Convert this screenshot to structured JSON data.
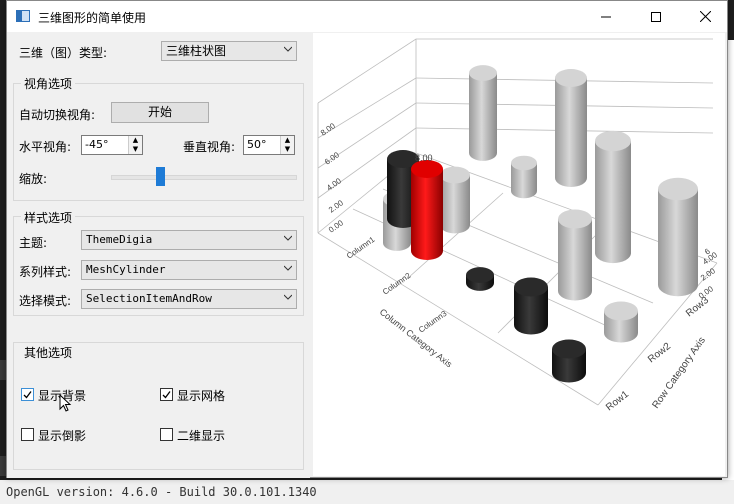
{
  "window": {
    "title": "三维图形的简单使用"
  },
  "background": {
    "status_text": "OpenGL version: 4.6.0 - Build 30.0.101.1340"
  },
  "graph_type": {
    "label": "三维（图）类型:",
    "value": "三维柱状图"
  },
  "view_options": {
    "title": "视角选项",
    "auto_rotate_label": "自动切换视角:",
    "start_button": "开始",
    "horizontal_label": "水平视角:",
    "horizontal_value": "-45°",
    "vertical_label": "垂直视角:",
    "vertical_value": "50°",
    "zoom_label": "缩放:",
    "zoom_level": 0.5
  },
  "style_options": {
    "title": "样式选项",
    "theme_label": "主题:",
    "theme_value": "ThemeDigia",
    "series_label": "系列样式:",
    "series_value": "MeshCylinder",
    "selection_label": "选择模式:",
    "selection_value": "SelectionItemAndRow"
  },
  "other_options": {
    "title": "其他选项",
    "show_background": {
      "label": "显示背景",
      "checked": true
    },
    "show_grid": {
      "label": "显示网格",
      "checked": true
    },
    "show_reflection": {
      "label": "显示倒影",
      "checked": false
    },
    "show_2d": {
      "label": "二维显示",
      "checked": false
    }
  },
  "chart": {
    "selected_value_label": "8.00",
    "y_ticks": [
      "0.00",
      "2.00",
      "4.00",
      "6.00",
      "8.00"
    ],
    "right_ticks": [
      "0.00",
      "2.00",
      "4.00",
      "6"
    ],
    "columns": [
      "Column1",
      "Column2",
      "Column3"
    ],
    "rows": [
      "Row1",
      "Row2",
      "Row3"
    ],
    "column_axis_title": "Column Category Axis",
    "row_axis_title": "Row Category Axis"
  },
  "colors": {
    "accent": "#1e7bd6",
    "selected_bar": "#d40000",
    "dark_bar": "#1e1e1e",
    "light_bar": "#c8c8c8"
  }
}
